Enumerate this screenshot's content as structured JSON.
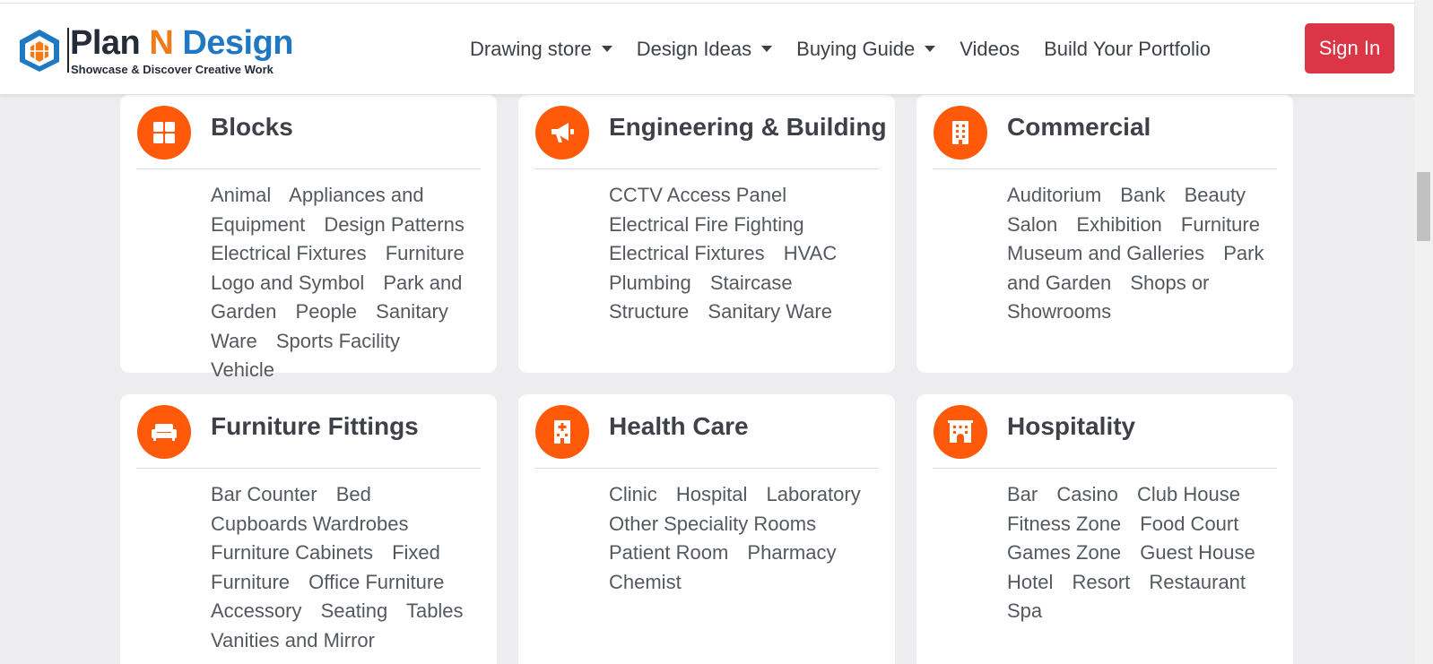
{
  "brand": {
    "title_part1": "Plan ",
    "title_part2": "N",
    "title_part3": " Design",
    "tagline": "Showcase & Discover Creative Work",
    "colors": {
      "dark": "#262b3a",
      "orange": "#f07b18",
      "blue": "#1f78c1"
    }
  },
  "nav": {
    "items": [
      {
        "label": "Drawing store",
        "dropdown": true
      },
      {
        "label": "Design Ideas",
        "dropdown": true
      },
      {
        "label": "Buying Guide",
        "dropdown": true
      },
      {
        "label": "Videos",
        "dropdown": false
      },
      {
        "label": "Build Your Portfolio",
        "dropdown": false
      }
    ],
    "sign_in": "Sign In"
  },
  "colors": {
    "accent": "#ff5a0a",
    "sign_in": "#dc3545",
    "background": "#ededef"
  },
  "cards": [
    {
      "title": "Blocks",
      "icon": "grid-icon",
      "links": [
        "Animal",
        "Appliances and Equipment",
        "Design Patterns",
        "Electrical Fixtures",
        "Furniture",
        "Logo and Symbol",
        "Park and Garden",
        "People",
        "Sanitary Ware",
        "Sports Facility",
        "Vehicle"
      ]
    },
    {
      "title": "Engineering & Building",
      "icon": "megaphone-icon",
      "links": [
        "CCTV Access Panel",
        "Electrical Fire Fighting",
        "Electrical Fixtures",
        "HVAC",
        "Plumbing",
        "Staircase",
        "Structure",
        "Sanitary Ware"
      ]
    },
    {
      "title": "Commercial",
      "icon": "building-icon",
      "links": [
        "Auditorium",
        "Bank",
        "Beauty Salon",
        "Exhibition",
        "Furniture",
        "Museum and Galleries",
        "Park and Garden",
        "Shops or Showrooms"
      ]
    },
    {
      "title": "Furniture Fittings",
      "icon": "sofa-icon",
      "links": [
        "Bar Counter",
        "Bed",
        "Cupboards Wardrobes",
        "Furniture Cabinets",
        "Fixed Furniture",
        "Office Furniture Accessory",
        "Seating",
        "Tables",
        "Vanities and Mirror"
      ]
    },
    {
      "title": "Health Care",
      "icon": "hospital-icon",
      "links": [
        "Clinic",
        "Hospital",
        "Laboratory",
        "Other Speciality Rooms",
        "Patient Room",
        "Pharmacy Chemist"
      ]
    },
    {
      "title": "Hospitality",
      "icon": "hotel-icon",
      "links": [
        "Bar",
        "Casino",
        "Club House",
        "Fitness Zone",
        "Food Court",
        "Games Zone",
        "Guest House",
        "Hotel",
        "Resort",
        "Restaurant",
        "Spa"
      ]
    }
  ]
}
